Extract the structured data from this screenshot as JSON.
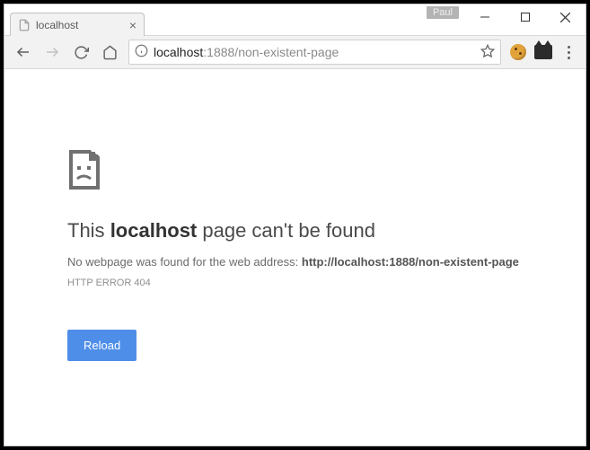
{
  "window": {
    "user_badge": "Paul"
  },
  "tab": {
    "title": "localhost"
  },
  "address_bar": {
    "host": "localhost",
    "rest": ":1888/non-existent-page"
  },
  "error_page": {
    "prefix": "This ",
    "host": "localhost",
    "suffix": " page can't be found",
    "sub_prefix": "No webpage was found for the web address: ",
    "sub_url": "http://localhost:1888/non-existent-page",
    "code": "HTTP ERROR 404",
    "reload_label": "Reload"
  }
}
